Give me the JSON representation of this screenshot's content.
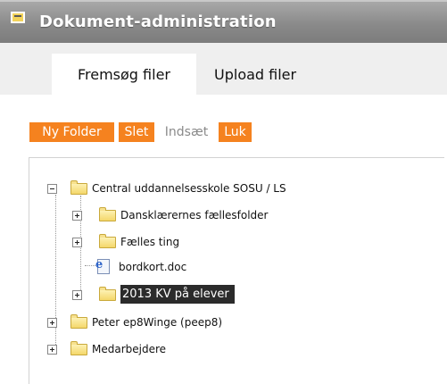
{
  "window": {
    "title": "Dokument-administration",
    "title_icon": "window-icon"
  },
  "tabs": [
    {
      "label": "Fremsøg filer",
      "active": true
    },
    {
      "label": "Upload filer",
      "active": false
    }
  ],
  "toolbar": {
    "new_folder": "Ny Folder",
    "delete": "Slet",
    "paste": "Indsæt",
    "close": "Luk"
  },
  "tree": {
    "root": {
      "label": "Central uddannelsesskole SOSU / LS",
      "expanded": true
    },
    "children": [
      {
        "label": "Dansklærernes fællesfolder",
        "type": "folder"
      },
      {
        "label": "Fælles ting",
        "type": "folder"
      },
      {
        "label": "bordkort.doc",
        "type": "file"
      },
      {
        "label": "2013 KV på elever",
        "type": "folder",
        "selected": true
      }
    ],
    "siblings": [
      {
        "label": "Peter ep8Winge (peep8)",
        "type": "folder"
      },
      {
        "label": "Medarbejdere",
        "type": "folder"
      }
    ]
  },
  "colors": {
    "accent": "#f5821f",
    "titlebar": "#8a8a8a",
    "selected_bg": "#2b2b2b"
  }
}
